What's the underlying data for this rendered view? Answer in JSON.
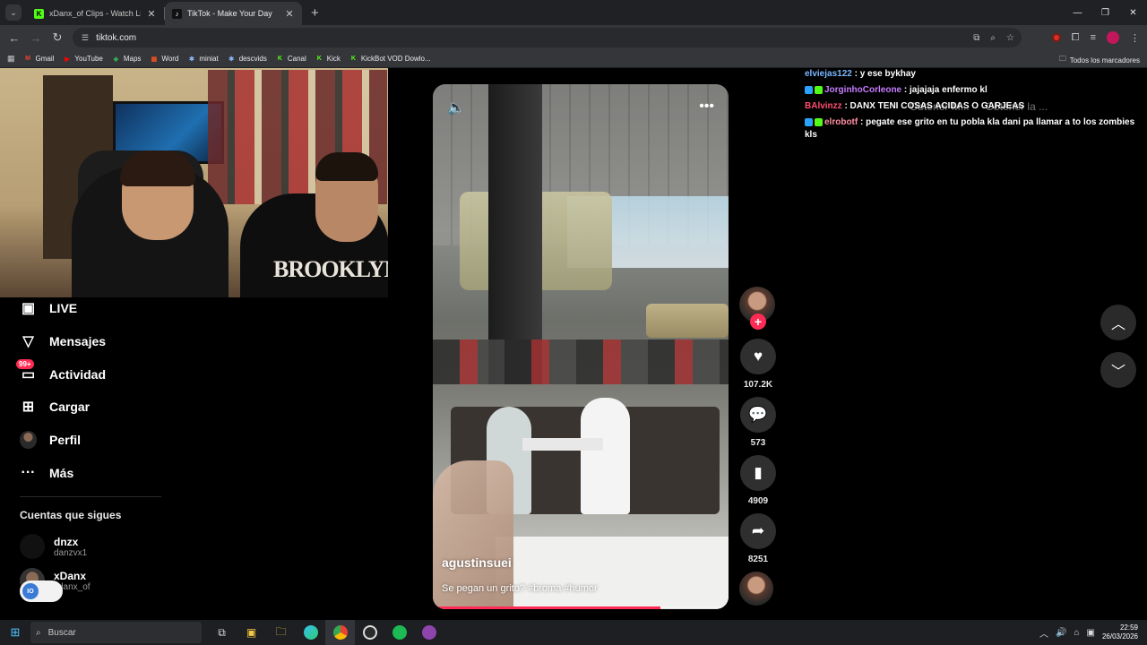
{
  "browser": {
    "tabs": [
      {
        "title": "xDanx_of Clips - Watch Live on",
        "favicon_color": "#53fc18",
        "favicon_glyph": "K",
        "active": false
      },
      {
        "title": "TikTok - Make Your Day",
        "favicon_color": "#111111",
        "favicon_glyph": "♪",
        "active": true
      }
    ],
    "url": "tiktok.com",
    "bookmarks": [
      {
        "label": "Gmail",
        "icon": "gmail-icon",
        "color": "#ea4335",
        "glyph": "M"
      },
      {
        "label": "YouTube",
        "icon": "youtube-icon",
        "color": "#ff0000",
        "glyph": "▶"
      },
      {
        "label": "Maps",
        "icon": "maps-icon",
        "color": "#34a853",
        "glyph": "◆"
      },
      {
        "label": "Word",
        "icon": "word-icon",
        "color": "#f25022",
        "glyph": "▦"
      },
      {
        "label": "miniat",
        "icon": "miniat-icon",
        "color": "#8ab4f8",
        "glyph": "✱"
      },
      {
        "label": "descvids",
        "icon": "descvids-icon",
        "color": "#8ab4f8",
        "glyph": "✱"
      },
      {
        "label": "Canal",
        "icon": "kick-icon",
        "color": "#53fc18",
        "glyph": "K"
      },
      {
        "label": "Kick",
        "icon": "kick-icon",
        "color": "#53fc18",
        "glyph": "K"
      },
      {
        "label": "KickBot VOD Dowlo...",
        "icon": "kickbot-icon",
        "color": "#53fc18",
        "glyph": "K"
      }
    ],
    "all_bookmarks": "Todos los marcadores"
  },
  "sidebar": {
    "items": [
      {
        "label": "LIVE",
        "icon": "live-icon",
        "glyph": "▣"
      },
      {
        "label": "Mensajes",
        "icon": "messages-icon",
        "glyph": "▽"
      },
      {
        "label": "Actividad",
        "icon": "activity-icon",
        "glyph": "▭",
        "badge": "99+"
      },
      {
        "label": "Cargar",
        "icon": "upload-icon",
        "glyph": "⊞"
      },
      {
        "label": "Perfil",
        "icon": "profile-avatar",
        "glyph": ""
      },
      {
        "label": "Más",
        "icon": "more-icon",
        "glyph": "···"
      }
    ],
    "following_title": "Cuentas que sigues",
    "following": [
      {
        "name": "dnzx",
        "handle": "danzvx1"
      },
      {
        "name": "xDanx",
        "handle": "xdanx_of"
      }
    ]
  },
  "video": {
    "author": "agustinsuei",
    "caption": "Se pegan un grito? #broma #humor",
    "progress": 0.77
  },
  "actions": {
    "likes": "107.2K",
    "comments": "573",
    "saves": "4909",
    "shares": "8251"
  },
  "chat": [
    {
      "user": "elviejas122",
      "user_color": "#7ab8ff",
      "message": " : y ese bykhay",
      "badges": []
    },
    {
      "user": "JorginhoCorleone",
      "user_color": "#c77dff",
      "message": " : jajajaja enfermo kl",
      "badges": [
        "#2aa3ff",
        "#53fc18"
      ]
    },
    {
      "user": "BAlvinzz",
      "user_color": "#ff4d6d",
      "message": " : DANX TENI COSAS ACIDAS O GARJEAS",
      "badges": []
    },
    {
      "user": "elrobotf",
      "user_color": "#ff8fa3",
      "message": " : pegate ese grito en tu pobla kla dani pa llamar a to los zombies kls",
      "badges": [
        "#2aa3ff",
        "#53fc18"
      ]
    }
  ],
  "ghost_ui": [
    "Obtener M...",
    "Obtener la ..."
  ],
  "taskbar": {
    "search_placeholder": "Buscar",
    "time": "22:59",
    "date": "26/03/2026"
  }
}
